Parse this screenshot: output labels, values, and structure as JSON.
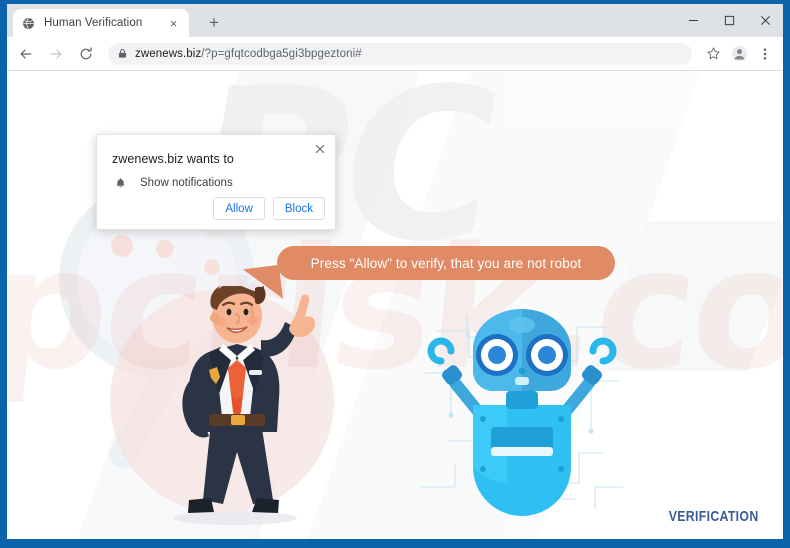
{
  "browser": {
    "tab": {
      "title": "Human Verification",
      "favicon_icon": "globe-icon",
      "close_icon": "×"
    },
    "new_tab_icon": "+",
    "window_controls": {
      "minimize": "—",
      "maximize": "☐",
      "close": "×"
    },
    "toolbar": {
      "back_icon": "←",
      "forward_icon": "→",
      "reload_icon": "⟳",
      "lock_icon": "lock-icon",
      "url_host": "zwenews.biz",
      "url_path": "/?p=gfqtcodbga5gi3bpgeztoni#",
      "bookmark_icon": "☆",
      "profile_icon": "profile-avatar-icon",
      "menu_icon": "⋮"
    }
  },
  "permission_dialog": {
    "title": "zwenews.biz wants to",
    "option_icon": "bell-icon",
    "option_label": "Show notifications",
    "allow_label": "Allow",
    "block_label": "Block",
    "close_icon": "✕"
  },
  "page": {
    "bubble_text": "Press \"Allow\" to verify, that you are not robot",
    "bubble_color": "#e08a66",
    "verification_label": "VERIFICATION",
    "verification_color": "#3a5a96",
    "watermark_text": "pcrisk.com",
    "watermark_text_2": "PC",
    "man_character": "businessman-pointing-up-illustration",
    "robot_character": "blue-robot-illustration",
    "background": "#ffffff"
  }
}
